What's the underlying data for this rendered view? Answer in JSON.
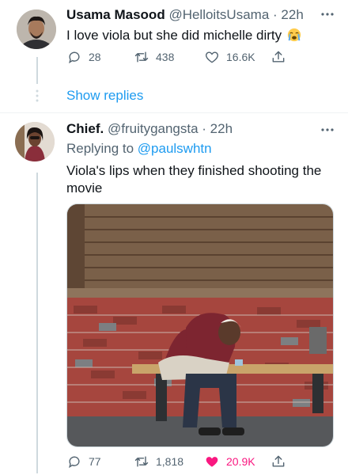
{
  "tweet1": {
    "name": "Usama Masood",
    "handle": "@HelloitsUsama",
    "separator": " · ",
    "time": "22h",
    "text": "I love viola but she did michelle dirty",
    "emoji": "loudly-crying-face",
    "replies": "28",
    "retweets": "438",
    "likes": "16.6K"
  },
  "show_replies": "Show replies",
  "tweet2": {
    "name": "Chief.",
    "handle": "@fruitygangsta",
    "separator": " · ",
    "time": "22h",
    "replying_prefix": "Replying to ",
    "replying_handle": "@paulswhtn",
    "text": "Viola's lips when they finished shooting the movie",
    "replies": "77",
    "retweets": "1,818",
    "likes": "20.9K",
    "liked": true
  },
  "colors": {
    "link": "#1d9bf0",
    "muted": "#536471",
    "like": "#f91880",
    "text": "#0f1419"
  }
}
